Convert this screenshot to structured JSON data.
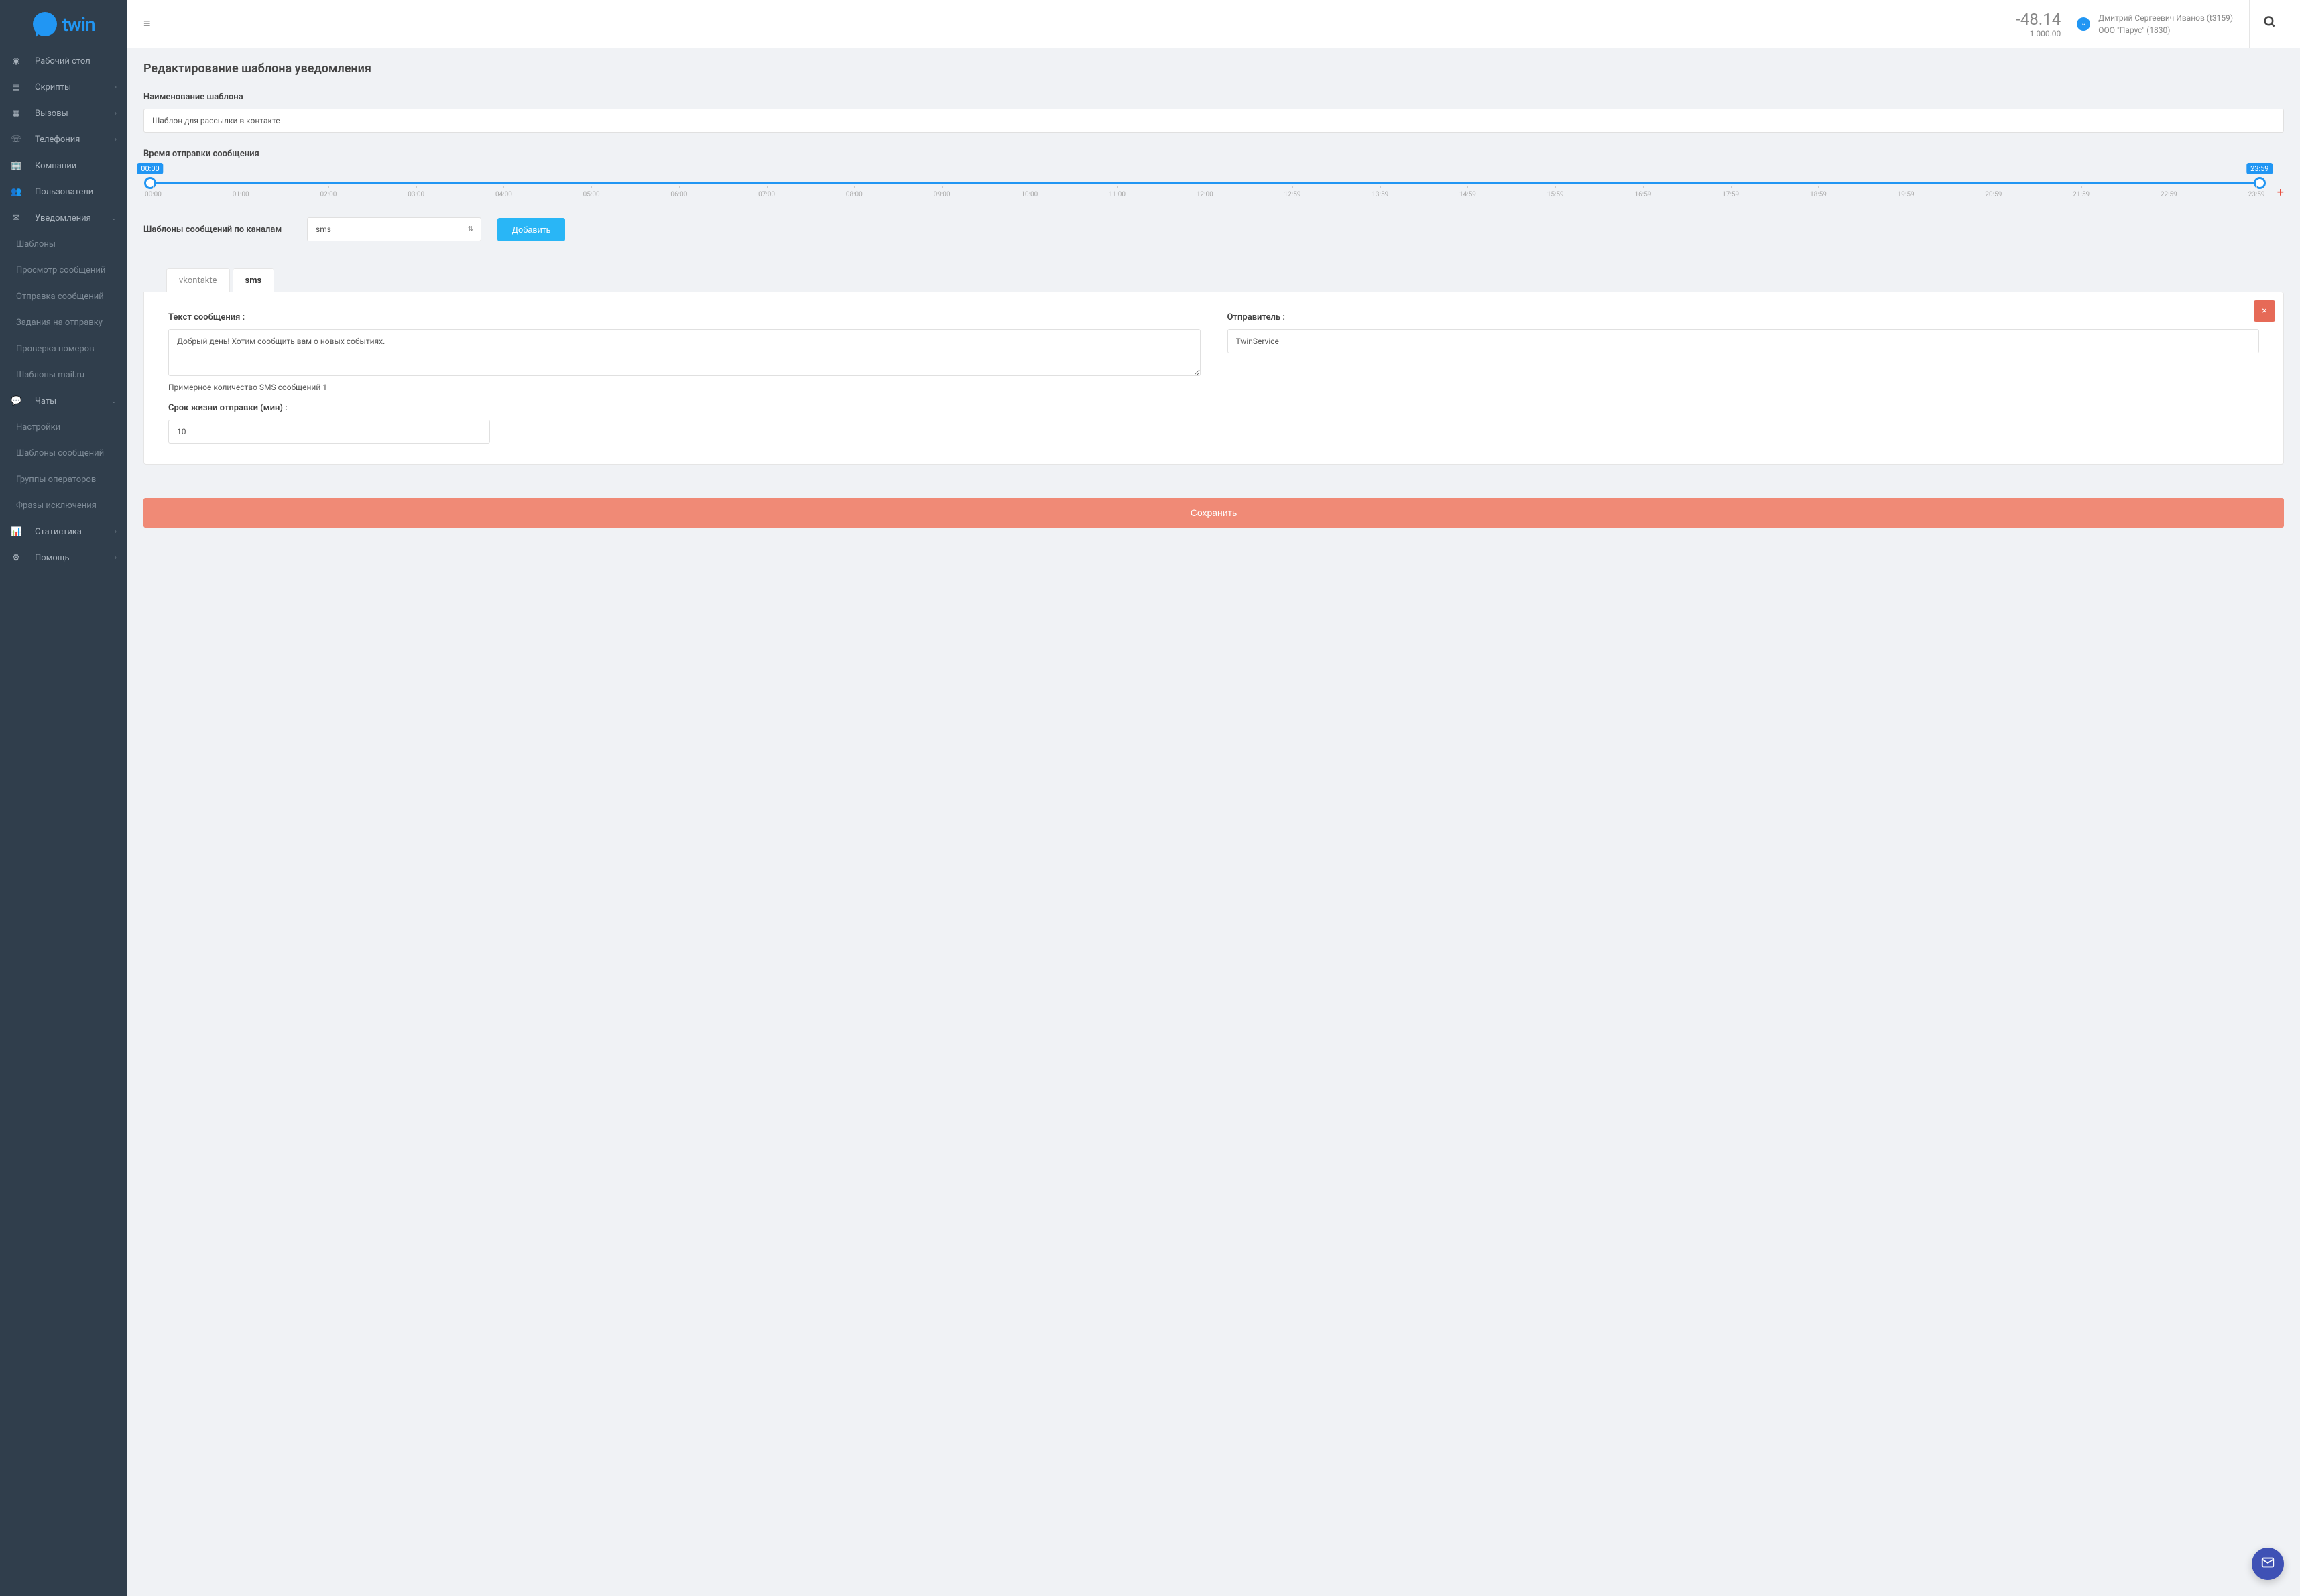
{
  "brand": "twin",
  "topbar": {
    "balance_main": "-48.14",
    "balance_sub": "1 000.00",
    "user_line1": "Дмитрий Сергеевич Иванов (t3159)",
    "user_line2": "ООО \"Парус\" (1830)"
  },
  "sidebar": {
    "items": [
      {
        "icon": "dashboard",
        "label": "Рабочий стол",
        "chevron": false
      },
      {
        "icon": "script",
        "label": "Скрипты",
        "chevron": true
      },
      {
        "icon": "calendar",
        "label": "Вызовы",
        "chevron": true
      },
      {
        "icon": "phone",
        "label": "Телефония",
        "chevron": true
      },
      {
        "icon": "building",
        "label": "Компании",
        "chevron": false
      },
      {
        "icon": "users",
        "label": "Пользователи",
        "chevron": false
      },
      {
        "icon": "mail",
        "label": "Уведомления",
        "chevron": true,
        "open": true
      }
    ],
    "sub1": [
      "Шаблоны",
      "Просмотр сообщений",
      "Отправка сообщений",
      "Задания на отправку",
      "Проверка номеров",
      "Шаблоны mail.ru"
    ],
    "chats": {
      "icon": "chat",
      "label": "Чаты",
      "chevron": true,
      "open": true
    },
    "sub2": [
      "Настройки",
      "Шаблоны сообщений",
      "Группы операторов",
      "Фразы исключения"
    ],
    "stats": {
      "icon": "chart",
      "label": "Статистика",
      "chevron": true
    },
    "help": {
      "icon": "gear",
      "label": "Помощь",
      "chevron": true
    }
  },
  "page": {
    "title": "Редактирование шаблона уведомления",
    "name_label": "Наименование шаблона",
    "name_value": "Шаблон для рассылки в контакте",
    "time_label": "Время отправки сообщения",
    "slider_start": "00:00",
    "slider_end": "23:59",
    "ticks": [
      "00:00",
      "01:00",
      "02:00",
      "03:00",
      "04:00",
      "05:00",
      "06:00",
      "07:00",
      "08:00",
      "09:00",
      "10:00",
      "11:00",
      "12:00",
      "12:59",
      "13:59",
      "14:59",
      "15:59",
      "16:59",
      "17:59",
      "18:59",
      "19:59",
      "20:59",
      "21:59",
      "22:59",
      "23:59"
    ],
    "channel_label": "Шаблоны сообщений по каналам",
    "channel_selected": "sms",
    "add_button": "Добавить",
    "tabs": [
      {
        "key": "vkontakte",
        "label": "vkontakte"
      },
      {
        "key": "sms",
        "label": "sms"
      }
    ],
    "active_tab": "sms",
    "panel": {
      "text_label": "Текст сообщения :",
      "text_value": "Добрый день! Хотим сообщить вам о новых событиях.",
      "sender_label": "Отправитель :",
      "sender_value": "TwinService",
      "sms_count_hint": "Примерное количество SMS сообщений 1",
      "ttl_label": "Срок жизни отправки (мин) :",
      "ttl_value": "10"
    },
    "save_button": "Сохранить"
  },
  "icons": {
    "dashboard": "◉",
    "script": "▤",
    "calendar": "▦",
    "phone": "☏",
    "building": "🏢",
    "users": "👥",
    "mail": "✉",
    "chat": "💬",
    "chart": "📊",
    "gear": "⚙",
    "search": "🔍",
    "chevron_right": "›",
    "chevron_down": "⌄",
    "plus": "+",
    "close": "×",
    "envelope": "✉",
    "sort": "⇅",
    "hamburger": "≡",
    "check_down": "⌄"
  }
}
